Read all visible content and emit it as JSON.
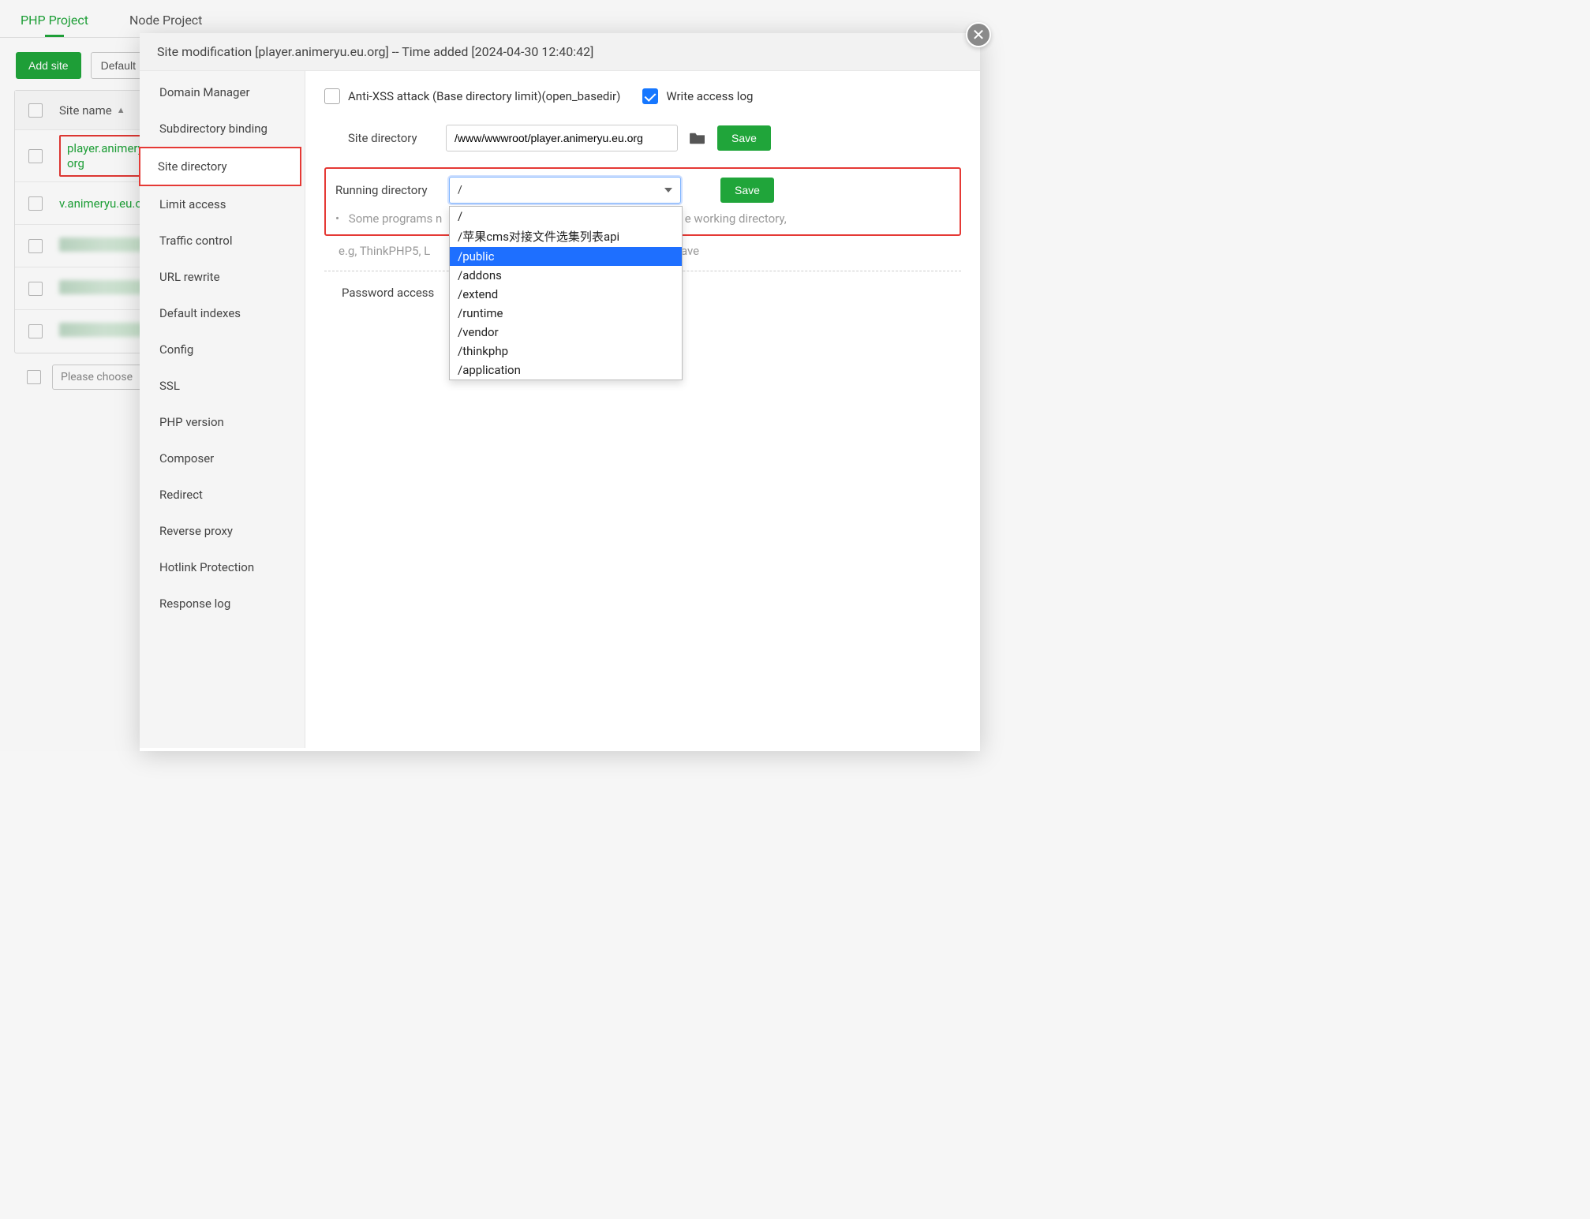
{
  "tabs": {
    "php": "PHP Project",
    "node": "Node Project"
  },
  "toolbar": {
    "add_site": "Add site",
    "default": "Default"
  },
  "table": {
    "header_sitename": "Site name",
    "rows": [
      {
        "name": "player.animeryu.eu.org",
        "highlight": true
      },
      {
        "name": "v.animeryu.eu.org",
        "highlight": false
      }
    ]
  },
  "footer": {
    "placeholder": "Please choose"
  },
  "modal": {
    "title": "Site modification [player.animeryu.eu.org] -- Time added [2024-04-30 12:40:42]",
    "side": [
      "Domain Manager",
      "Subdirectory binding",
      "Site directory",
      "Limit access",
      "Traffic control",
      "URL rewrite",
      "Default indexes",
      "Config",
      "SSL",
      "PHP version",
      "Composer",
      "Redirect",
      "Reverse proxy",
      "Hotlink Protection",
      "Response log"
    ],
    "active_side_index": 2,
    "anti_xss_label": "Anti-XSS attack (Base directory limit)(open_basedir)",
    "write_log_label": "Write access log",
    "site_dir_label": "Site directory",
    "site_dir_value": "/www/wwwroot/player.animeryu.eu.org",
    "save_label": "Save",
    "running_dir_label": "Running directory",
    "running_dir_value": "/",
    "running_dir_options": [
      "/",
      "/苹果cms对接文件选集列表api",
      "/public",
      "/addons",
      "/extend",
      "/runtime",
      "/vendor",
      "/thinkphp",
      "/application"
    ],
    "running_dir_selected_index": 2,
    "note_line1_a": "Some programs n",
    "note_line1_b": "e working directory,",
    "note_line2_a": "e.g, ThinkPHP5, L",
    "note_line2_b": "k Save",
    "password_access_label": "Password access"
  }
}
